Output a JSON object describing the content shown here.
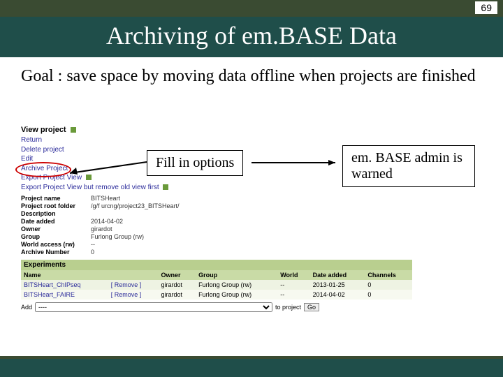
{
  "page_number": "69",
  "title": "Archiving of em.BASE Data",
  "goal": "Goal : save space by moving data offline when projects are finished",
  "callouts": {
    "fill": "Fill in options",
    "warned": "em. BASE admin is warned"
  },
  "view_project": {
    "heading": "View project",
    "links": {
      "return": "Return",
      "delete": "Delete project",
      "edit": "Edit",
      "archive": "Archive Project",
      "export": "Export Project View",
      "export_remove": "Export Project View but remove old view first"
    }
  },
  "fields": {
    "project_name": {
      "label": "Project name",
      "value": "BITSHeart"
    },
    "root_folder": {
      "label": "Project root folder",
      "value": "/g/f urcng/project23_BITSHeart/"
    },
    "description": {
      "label": "Description",
      "value": ""
    },
    "date_added": {
      "label": "Date added",
      "value": "2014-04-02"
    },
    "owner": {
      "label": "Owner",
      "value": "girardot"
    },
    "group": {
      "label": "Group",
      "value": "Furlong Group (rw)"
    },
    "world": {
      "label": "World access (rw)",
      "value": "--"
    },
    "archive_no": {
      "label": "Archive Number",
      "value": "0"
    }
  },
  "experiments": {
    "section": "Experiments",
    "headers": {
      "name": "Name",
      "owner": "Owner",
      "group": "Group",
      "world": "World",
      "date": "Date added",
      "channels": "Channels"
    },
    "remove": "[ Remove ]",
    "rows": [
      {
        "name": "BITSHeart_ChIPseq",
        "owner": "girardot",
        "group": "Furlong Group (rw)",
        "world": "--",
        "date": "2013-01-25",
        "channels": "0"
      },
      {
        "name": "BITSHeart_FAIRE",
        "owner": "girardot",
        "group": "Furlong Group (rw)",
        "world": "--",
        "date": "2014-04-02",
        "channels": "0"
      }
    ]
  },
  "addrow": {
    "label": "Add",
    "placeholder": "----",
    "suffix": "to project",
    "go": "Go"
  }
}
